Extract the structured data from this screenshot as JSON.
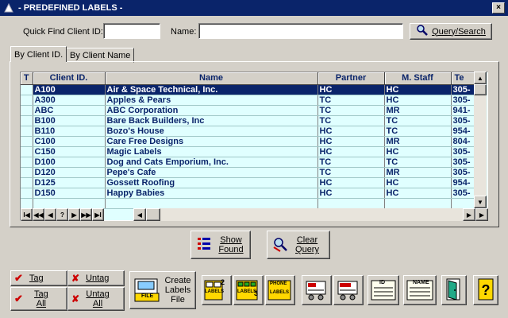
{
  "window": {
    "title": "- PREDEFINED LABELS -",
    "close_label": "×"
  },
  "search": {
    "client_id_label": "Quick Find Client ID:",
    "client_id_value": "",
    "name_label": "Name:",
    "name_value": "",
    "query_button": "Query/Search"
  },
  "tabs": [
    {
      "label": "By Client ID."
    },
    {
      "label": "By Client Name"
    }
  ],
  "grid": {
    "columns": [
      "T",
      "Client ID.",
      "Name",
      "Partner",
      "M. Staff",
      "Te"
    ],
    "rows": [
      {
        "t": "",
        "id": "A100",
        "name": "Air & Space Technical, Inc.",
        "partner": "HC",
        "staff": "HC",
        "tel": "305-"
      },
      {
        "t": "",
        "id": "A300",
        "name": "Apples & Pears",
        "partner": "TC",
        "staff": "HC",
        "tel": "305-"
      },
      {
        "t": "",
        "id": "ABC",
        "name": "ABC Corporation",
        "partner": "TC",
        "staff": "MR",
        "tel": "941-"
      },
      {
        "t": "",
        "id": "B100",
        "name": "Bare Back Builders, Inc",
        "partner": "TC",
        "staff": "TC",
        "tel": "305-"
      },
      {
        "t": "",
        "id": "B110",
        "name": "Bozo's House",
        "partner": "HC",
        "staff": "TC",
        "tel": "954-"
      },
      {
        "t": "",
        "id": "C100",
        "name": "Care Free Designs",
        "partner": "HC",
        "staff": "MR",
        "tel": "804-"
      },
      {
        "t": "",
        "id": "C150",
        "name": "Magic Labels",
        "partner": "HC",
        "staff": "HC",
        "tel": "305-"
      },
      {
        "t": "",
        "id": "D100",
        "name": "Dog and Cats Emporium, Inc.",
        "partner": "TC",
        "staff": "TC",
        "tel": "305-"
      },
      {
        "t": "",
        "id": "D120",
        "name": "Pepe's Cafe",
        "partner": "TC",
        "staff": "MR",
        "tel": "305-"
      },
      {
        "t": "",
        "id": "D125",
        "name": "Gossett Roofing",
        "partner": "HC",
        "staff": "HC",
        "tel": "954-"
      },
      {
        "t": "",
        "id": "D150",
        "name": "Happy Babies",
        "partner": "HC",
        "staff": "HC",
        "tel": "305-"
      }
    ],
    "nav_buttons": [
      "I◀",
      "◀◀",
      "◀",
      "?",
      "▶",
      "▶▶",
      "▶I"
    ]
  },
  "actions": {
    "show_found": "Show Found",
    "clear_query": "Clear Query",
    "tag": "Tag",
    "untag": "Untag",
    "tag_all": "Tag All",
    "untag_all": "Untag All",
    "create_labels_file": "Create Labels File",
    "file_icon_text": "FILE",
    "labels2_text": "LABELS",
    "labels3_text": "LABELS",
    "phone_text": "PHONE",
    "phone_labels_text": "LABELS",
    "id_card_text": "ID",
    "name_card_text": "NAME"
  },
  "colors": {
    "titlebar": "#0a246a",
    "grid_bg": "#e0ffff",
    "selection": "#0a246a",
    "header_text": "#0a246a"
  }
}
